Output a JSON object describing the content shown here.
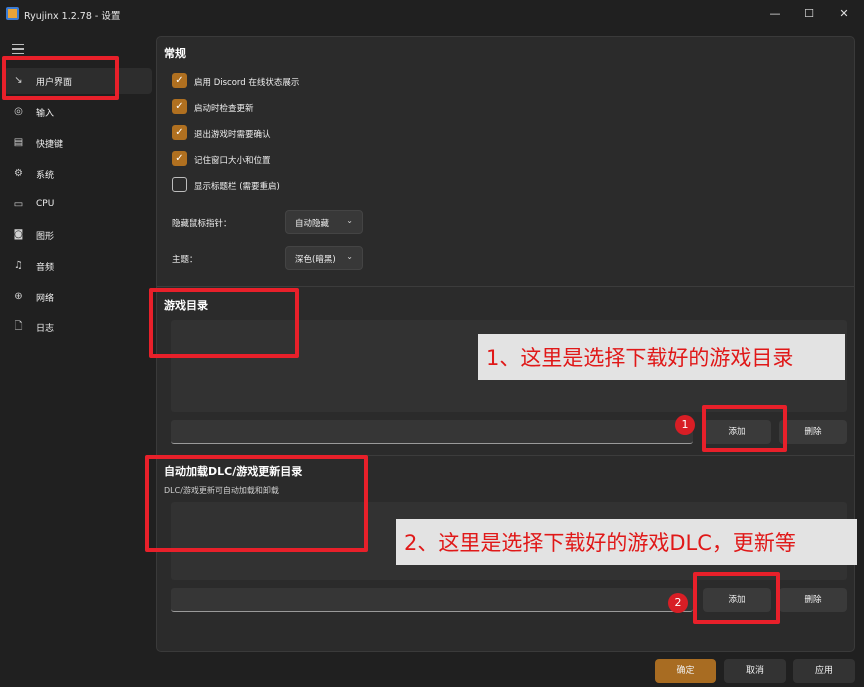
{
  "window": {
    "title": "Ryujinx 1.2.78 - 设置",
    "minimize": "—",
    "maximize": "☐",
    "close": "✕"
  },
  "sidebar": {
    "items": [
      {
        "label": "用户界面",
        "icon": "↘"
      },
      {
        "label": "输入",
        "icon": "◎"
      },
      {
        "label": "快捷键",
        "icon": "▤"
      },
      {
        "label": "系统",
        "icon": "⚙"
      },
      {
        "label": "CPU",
        "icon": "▭"
      },
      {
        "label": "图形",
        "icon": "◙"
      },
      {
        "label": "音频",
        "icon": "♫"
      },
      {
        "label": "网络",
        "icon": "⊕"
      },
      {
        "label": "日志",
        "icon": "🗋"
      }
    ]
  },
  "general": {
    "title": "常规",
    "options": [
      {
        "label": "启用 Discord 在线状态展示",
        "checked": true
      },
      {
        "label": "启动时检查更新",
        "checked": true
      },
      {
        "label": "退出游戏时需要确认",
        "checked": true
      },
      {
        "label": "记住窗口大小和位置",
        "checked": true
      },
      {
        "label": "显示标题栏 (需要重启)",
        "checked": false
      }
    ],
    "cursor_label": "隐藏鼠标指针：",
    "cursor_value": "自动隐藏",
    "theme_label": "主题：",
    "theme_value": "深色(暗黑)"
  },
  "game_dirs": {
    "title": "游戏目录",
    "add_label": "添加",
    "remove_label": "删除"
  },
  "autoload": {
    "title": "自动加载DLC/游戏更新目录",
    "subtitle": "DLC/游戏更新可自动加载和卸载",
    "add_label": "添加",
    "remove_label": "删除"
  },
  "annotations": {
    "callout1": "1、这里是选择下载好的游戏目录",
    "callout2": "2、这里是选择下载好的游戏DLC，更新等",
    "badge1": "1",
    "badge2": "2"
  },
  "footer": {
    "ok_label": "确定",
    "cancel_label": "取消",
    "apply_label": "应用"
  },
  "colors": {
    "accent": "#b07020",
    "annotation_red": "#e8202a"
  }
}
